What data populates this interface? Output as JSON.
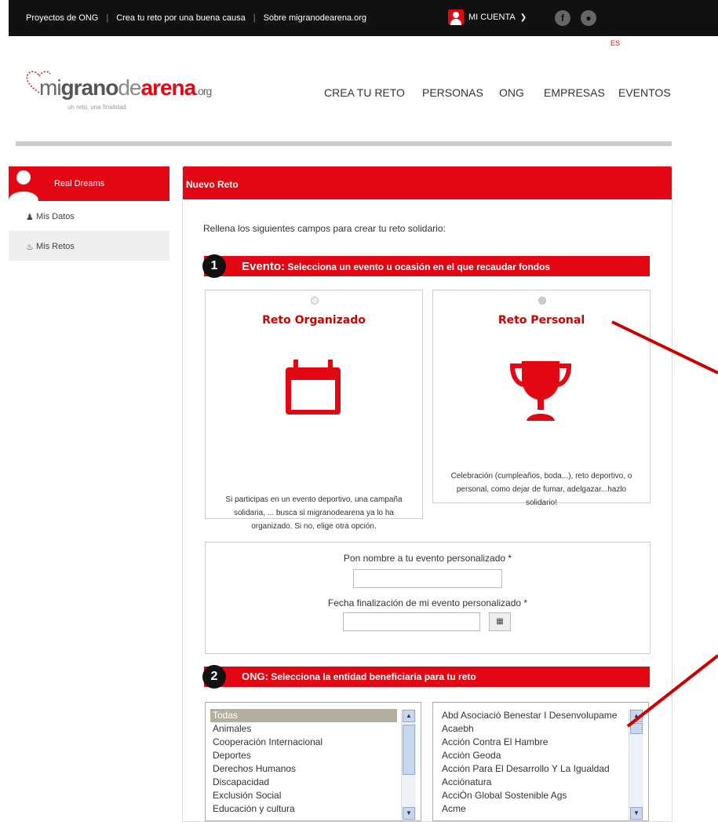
{
  "topbar": {
    "links": [
      "Proyectos de ONG",
      "Crea tu reto por una buena causa",
      "Sobre migranodearena.org"
    ],
    "account_label": "MI CUENTA",
    "social": [
      "facebook-icon",
      "twitter-icon"
    ],
    "lang": "ES"
  },
  "logo": {
    "part1": "mi",
    "part2": "grano",
    "part3": "de",
    "part4": "arena",
    "part5": ".org",
    "tagline": "un reto, una finalidad"
  },
  "nav": [
    "CREA TU RETO",
    "PERSONAS",
    "ONG",
    "EMPRESAS",
    "EVENTOS"
  ],
  "sidebar": {
    "user": "Real Dreams",
    "items": [
      {
        "label": "Mis Datos",
        "icon": "user-icon"
      },
      {
        "label": "Mis Retos",
        "icon": "flame-icon"
      }
    ]
  },
  "main": {
    "title": "Nuevo Reto",
    "intro": "Rellena los siguientes campos para crear tu reto solidario:",
    "step1": {
      "num": "1",
      "big": "Evento:",
      "text": " Selecciona un evento u ocasión en el que recaudar fondos"
    },
    "step2": {
      "num": "2",
      "big": "ONG:",
      "text": " Selecciona la entidad beneficiaria para tu reto"
    },
    "cards": [
      {
        "title": "Reto Organizado",
        "icon": "calendar-icon",
        "selected": false,
        "desc": "Si participas en un evento deportivo, una campaña solidaria, ... busca si migranodearena ya lo ha organizado. Si no, elige otra opción."
      },
      {
        "title": "Reto Personal",
        "icon": "trophy-icon",
        "selected": true,
        "desc": "Celebración (cumpleaños, boda...), reto deportivo, o personal, como dejar de fumar, adelgazar...hazlo solidario!"
      }
    ],
    "form": {
      "name_label": "Pon nombre a tu evento personalizado *",
      "name_value": "",
      "date_label": "Fecha finalización de mi evento personalizado *",
      "date_value": ""
    },
    "categories": [
      "Todas",
      "Animales",
      "Cooperación Internacional",
      "Deportes",
      "Derechos Humanos",
      "Discapacidad",
      "Exclusión Social",
      "Educación y cultura"
    ],
    "selected_category": "Todas",
    "ongs": [
      "Abd Asociació Benestar I Desenvolupame",
      "Acaebh",
      "Acción Contra El Hambre",
      "Acción Geoda",
      "Acción Para El Desarrollo Y La Igualdad",
      "Acciónatura",
      "AcciÓn Global Sostenible Ags",
      "Acme"
    ]
  },
  "colors": {
    "accent": "#e30613",
    "dark": "#111111"
  }
}
